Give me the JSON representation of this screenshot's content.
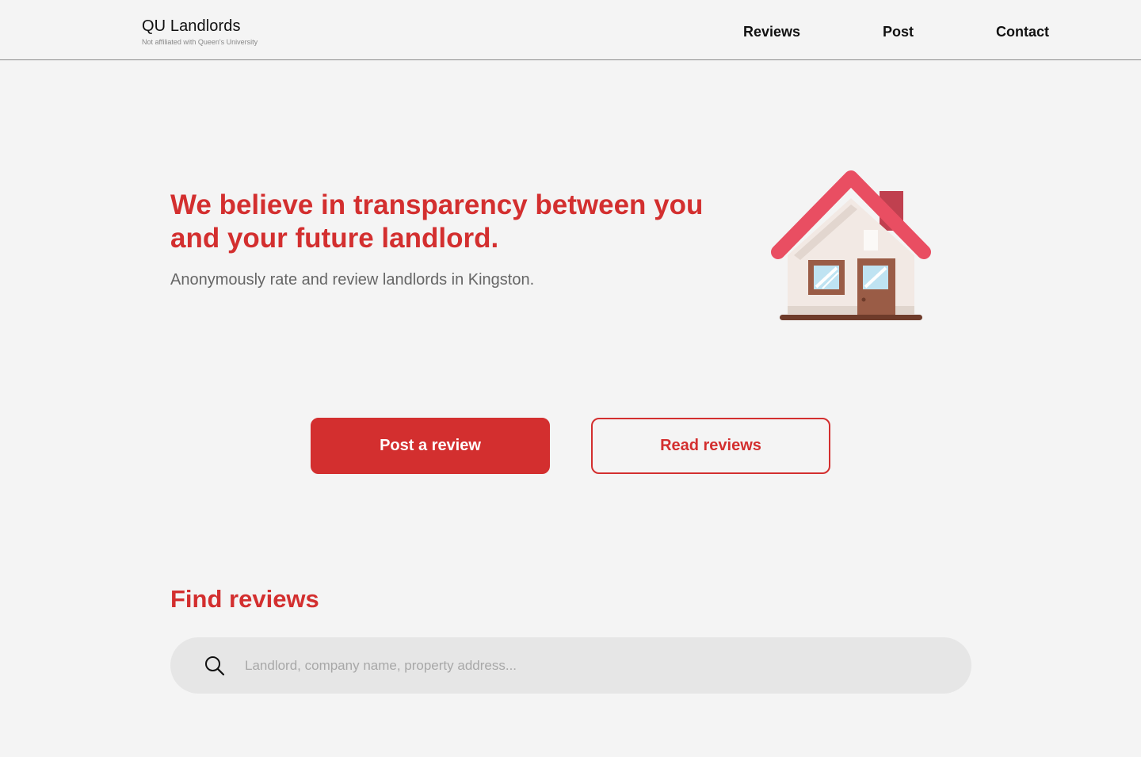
{
  "header": {
    "brand_title": "QU Landlords",
    "brand_subtitle": "Not affiliated with Queen's University",
    "nav": {
      "reviews": "Reviews",
      "post": "Post",
      "contact": "Contact"
    }
  },
  "hero": {
    "title": "We believe in transparency between you and your future landlord.",
    "subtitle": "Anonymously rate and review landlords in Kingston.",
    "illustration": "house-icon"
  },
  "actions": {
    "post_review": "Post a review",
    "read_reviews": "Read reviews"
  },
  "find": {
    "title": "Find reviews",
    "search_placeholder": "Landlord, company name, property address...",
    "search_value": "",
    "search_icon": "search-icon"
  },
  "colors": {
    "accent": "#d32f2f",
    "background": "#f4f4f4",
    "search_bg": "#e6e6e6"
  }
}
